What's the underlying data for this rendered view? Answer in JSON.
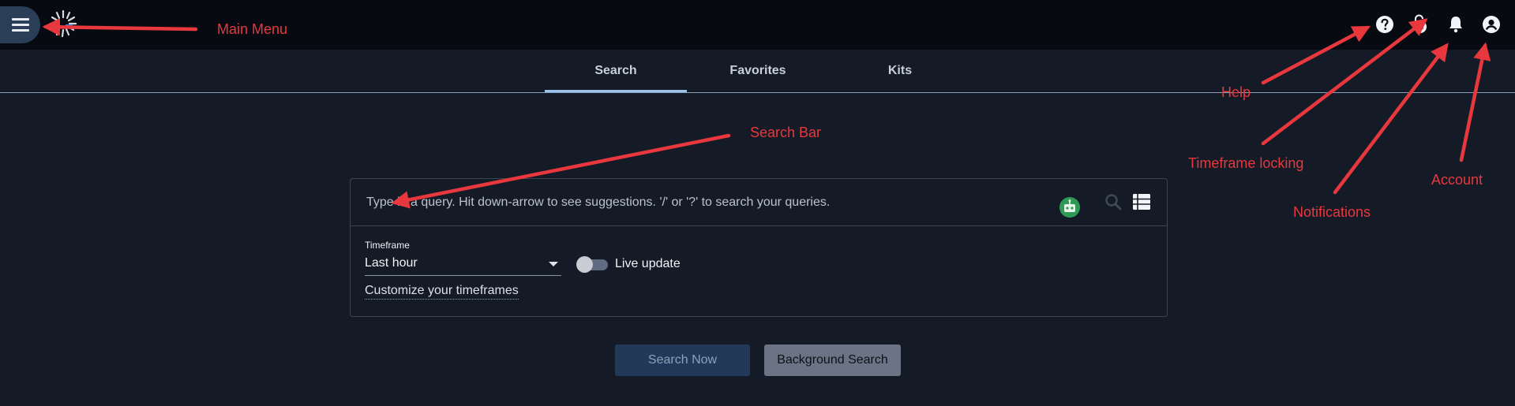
{
  "header": {
    "menu_icon": "hamburger-menu-icon",
    "logo_icon": "burst-logo-icon",
    "icons": [
      {
        "name": "help-icon"
      },
      {
        "name": "timeframe-lock-icon"
      },
      {
        "name": "notifications-bell-icon"
      },
      {
        "name": "account-icon"
      }
    ]
  },
  "tabs": [
    {
      "label": "Search",
      "active": true
    },
    {
      "label": "Favorites",
      "active": false
    },
    {
      "label": "Kits",
      "active": false
    }
  ],
  "search": {
    "placeholder": "Type in a query. Hit down-arrow to see suggestions. '/' or '?' to search your queries.",
    "value": ""
  },
  "timeframe": {
    "label": "Timeframe",
    "value": "Last hour",
    "customize_link": "Customize your timeframes"
  },
  "live_update": {
    "label": "Live update",
    "enabled": false
  },
  "buttons": {
    "search_now": "Search Now",
    "background_search": "Background Search"
  },
  "annotations": {
    "main_menu": "Main Menu",
    "search_bar": "Search Bar",
    "help": "Help",
    "timeframe_locking": "Timeframe locking",
    "notifications": "Notifications",
    "account": "Account"
  },
  "colors": {
    "background": "#141b27",
    "topbar": "#070a10",
    "accent": "#9cc3ec",
    "annotation": "#e8383d",
    "primary_button": "#23395a",
    "secondary_button": "#6a7484"
  }
}
